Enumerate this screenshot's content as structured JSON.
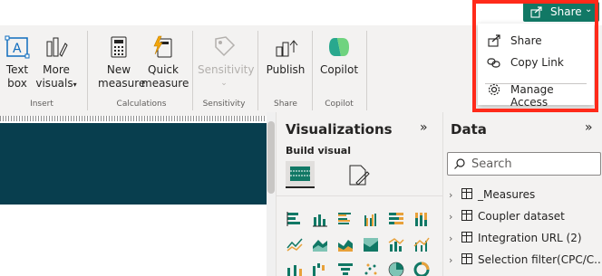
{
  "ribbon": {
    "insert": {
      "text_box": "Text\nbox",
      "more_visuals": "More\nvisuals",
      "group_label": "Insert"
    },
    "calculations": {
      "new_measure": "New\nmeasure",
      "quick_measure": "Quick\nmeasure",
      "group_label": "Calculations"
    },
    "sensitivity": {
      "button": "Sensitivity",
      "group_label": "Sensitivity"
    },
    "share": {
      "publish": "Publish",
      "group_label": "Share"
    },
    "copilot": {
      "button": "Copilot",
      "group_label": "Copilot"
    }
  },
  "share_button": {
    "label": "Share"
  },
  "share_menu": {
    "items": [
      {
        "label": "Share",
        "icon": "share-icon"
      },
      {
        "label": "Copy Link",
        "icon": "link-icon"
      },
      {
        "label": "Manage Access",
        "icon": "gear-icon"
      }
    ]
  },
  "visualizations": {
    "title": "Visualizations",
    "build_visual": "Build visual"
  },
  "data_pane": {
    "title": "Data",
    "search_placeholder": "Search",
    "items": [
      {
        "label": "_Measures"
      },
      {
        "label": "Coupler dataset"
      },
      {
        "label": "Integration URL (2)"
      },
      {
        "label": "Selection filter(CPC/C..."
      }
    ]
  },
  "colors": {
    "share_green": "#117865",
    "canvas_band": "#083e4e",
    "highlight_red": "#ff2a1a"
  }
}
